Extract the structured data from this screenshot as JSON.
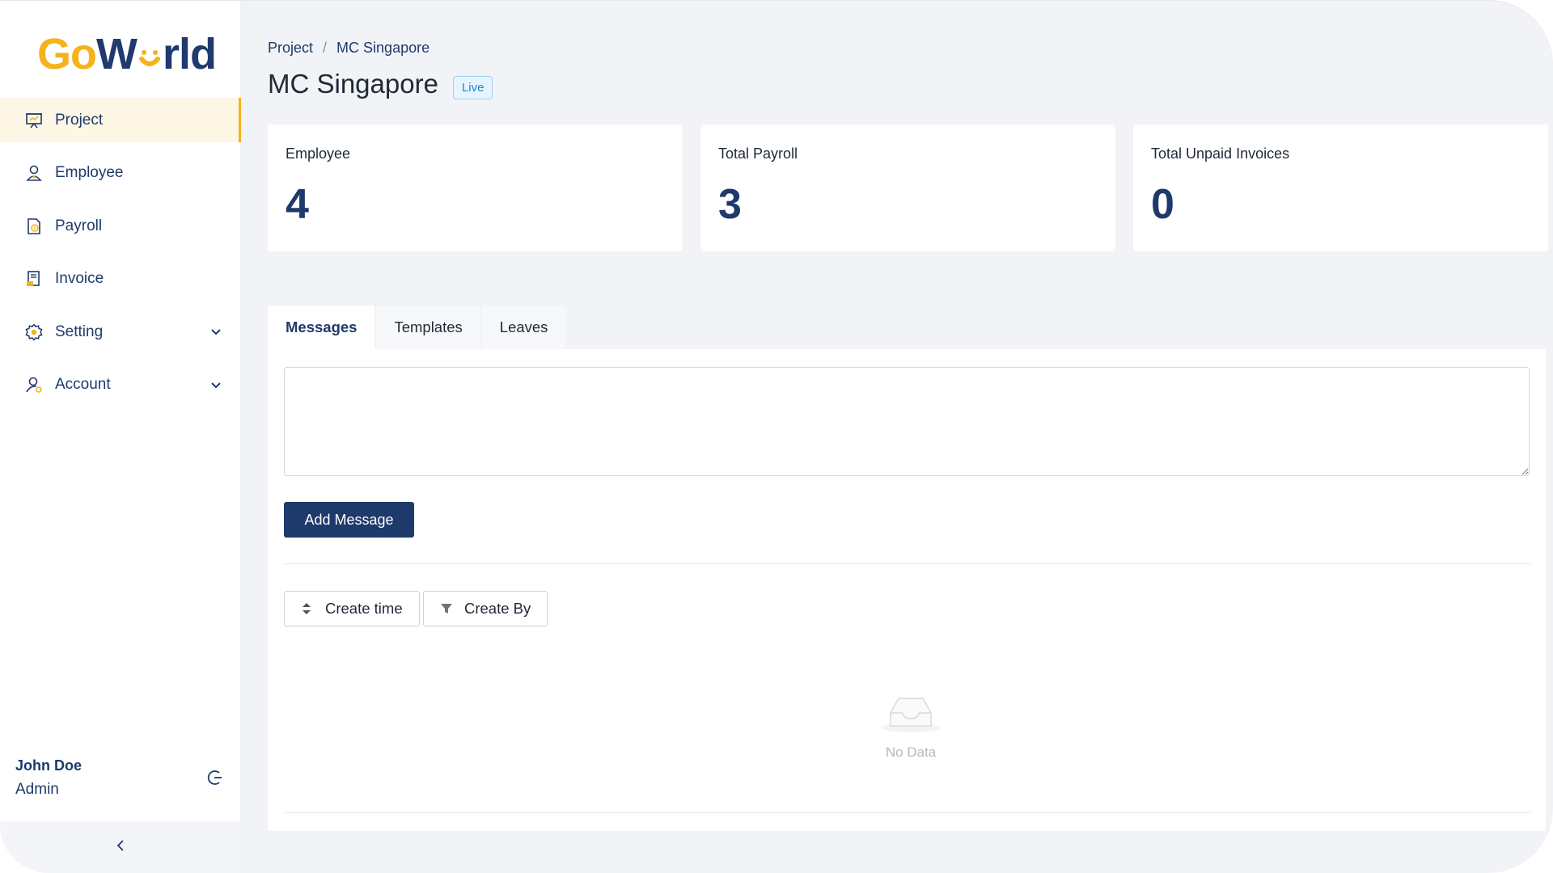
{
  "app": {
    "logo_text_left": "Go",
    "logo_text_right": "rld",
    "logo_full": "GoWorld"
  },
  "sidebar": {
    "items": [
      {
        "label": "Project",
        "icon": "presentation-icon",
        "active": true
      },
      {
        "label": "Employee",
        "icon": "user-icon"
      },
      {
        "label": "Payroll",
        "icon": "payroll-doc-icon"
      },
      {
        "label": "Invoice",
        "icon": "invoice-icon"
      },
      {
        "label": "Setting",
        "icon": "gear-icon",
        "expandable": true
      },
      {
        "label": "Account",
        "icon": "account-icon",
        "expandable": true
      }
    ],
    "user": {
      "name": "John Doe",
      "role": "Admin"
    }
  },
  "breadcrumb": {
    "root": "Project",
    "separator": "/",
    "current": "MC Singapore"
  },
  "page": {
    "title": "MC Singapore",
    "status": "Live"
  },
  "stats": [
    {
      "label": "Employee",
      "value": "4"
    },
    {
      "label": "Total Payroll",
      "value": "3"
    },
    {
      "label": "Total Unpaid Invoices",
      "value": "0"
    }
  ],
  "tabs": [
    {
      "label": "Messages",
      "active": true
    },
    {
      "label": "Templates"
    },
    {
      "label": "Leaves"
    }
  ],
  "messages": {
    "input_value": "",
    "add_button": "Add Message",
    "filters": [
      {
        "label": "Create time",
        "icon": "sort-icon"
      },
      {
        "label": "Create By",
        "icon": "filter-icon"
      }
    ],
    "empty_text": "No Data"
  },
  "colors": {
    "brand_navy": "#1e3a6b",
    "brand_yellow": "#f5b21a",
    "live_blue": "#1e88d8",
    "background": "#f1f3f6"
  }
}
